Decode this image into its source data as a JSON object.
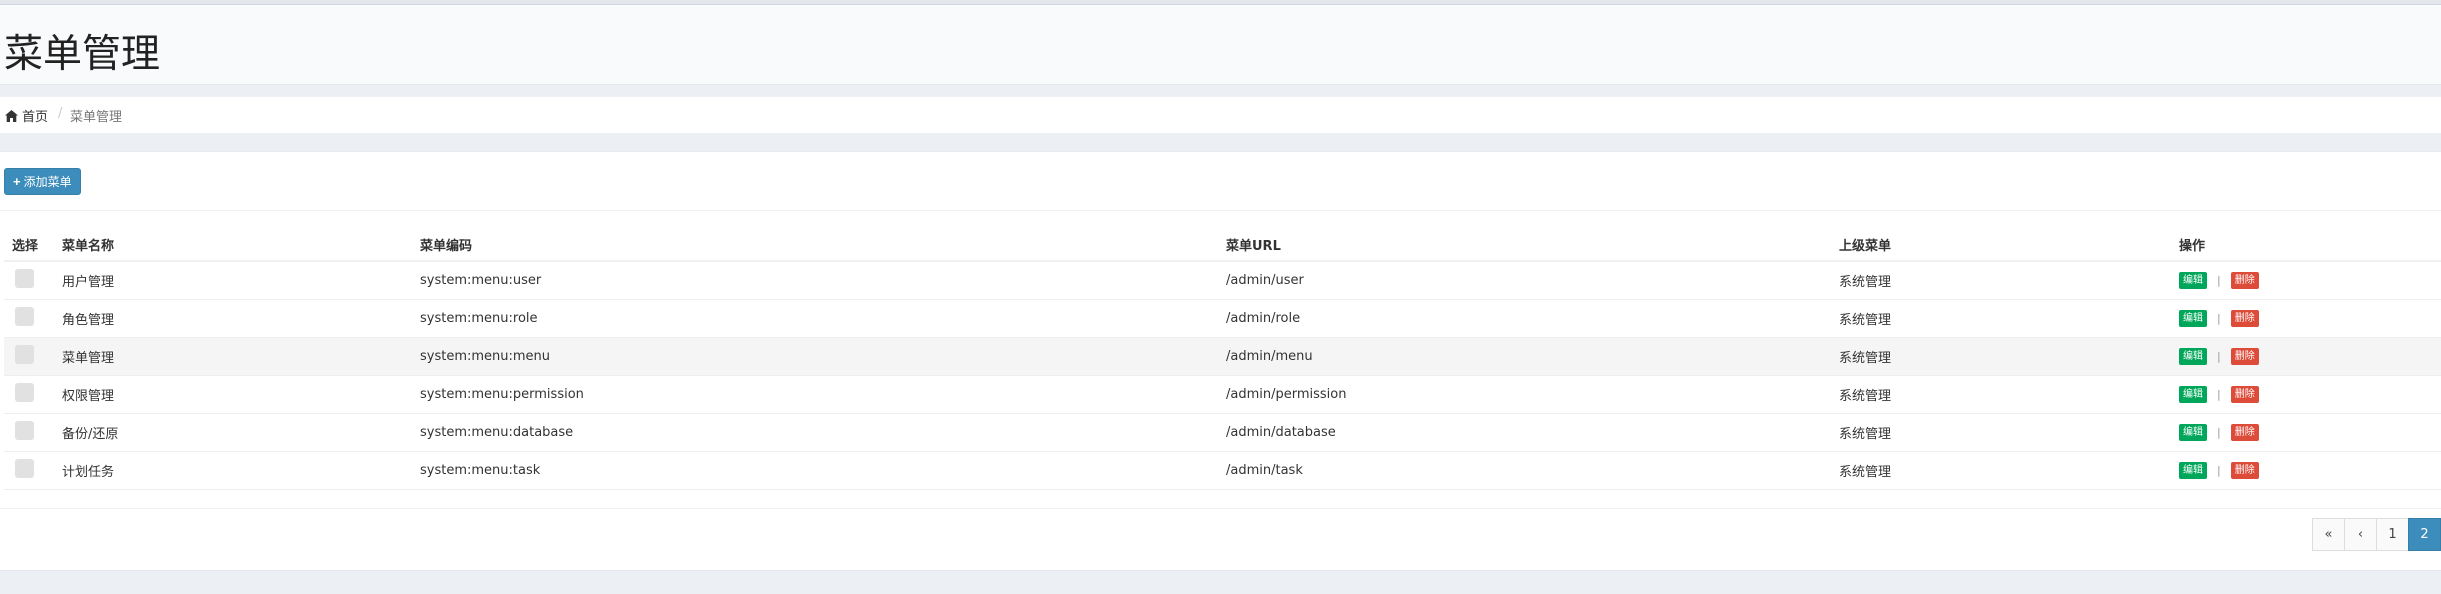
{
  "page": {
    "title": "菜单管理"
  },
  "breadcrumb": {
    "home_label": "首页",
    "separator": "/",
    "current": "菜单管理"
  },
  "toolbar": {
    "add_label": "添加菜单"
  },
  "table": {
    "headers": [
      "选择",
      "菜单名称",
      "菜单编码",
      "菜单URL",
      "上级菜单",
      "操作"
    ],
    "rows": [
      {
        "name": "用户管理",
        "code": "system:menu:user",
        "url": "/admin/user",
        "parent": "系统管理"
      },
      {
        "name": "角色管理",
        "code": "system:menu:role",
        "url": "/admin/role",
        "parent": "系统管理"
      },
      {
        "name": "菜单管理",
        "code": "system:menu:menu",
        "url": "/admin/menu",
        "parent": "系统管理"
      },
      {
        "name": "权限管理",
        "code": "system:menu:permission",
        "url": "/admin/permission",
        "parent": "系统管理"
      },
      {
        "name": "备份/还原",
        "code": "system:menu:database",
        "url": "/admin/database",
        "parent": "系统管理"
      },
      {
        "name": "计划任务",
        "code": "system:menu:task",
        "url": "/admin/task",
        "parent": "系统管理"
      }
    ],
    "actions": {
      "edit_label": "编辑",
      "delete_label": "删除",
      "separator": "|"
    }
  },
  "pagination": {
    "first": "«",
    "prev": "‹",
    "pages": [
      "1",
      "2"
    ],
    "active_page": "2"
  },
  "colors": {
    "primary": "#3c8dbc",
    "success": "#00a65a",
    "danger": "#dd4b39",
    "background": "#ecf0f5"
  },
  "icons": {
    "home": "home-icon",
    "plus": "plus-icon"
  }
}
